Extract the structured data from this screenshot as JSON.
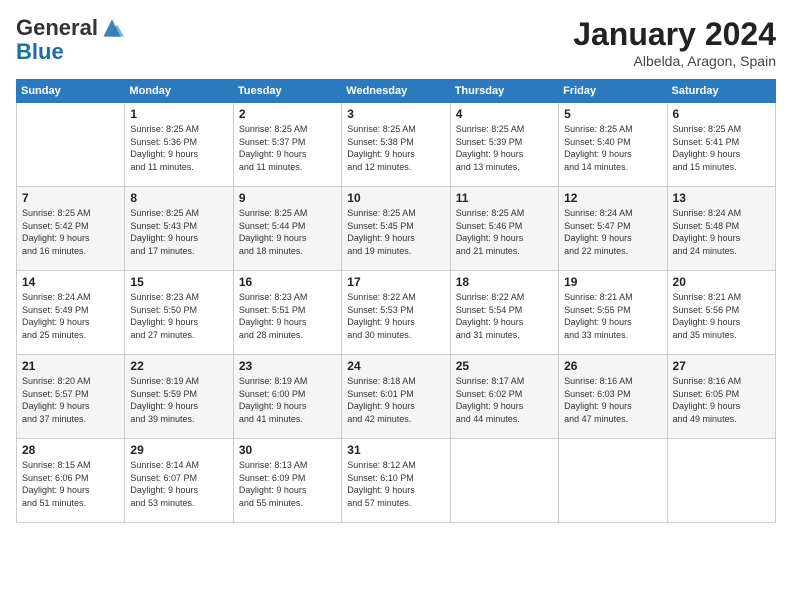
{
  "logo": {
    "general": "General",
    "blue": "Blue"
  },
  "title": "January 2024",
  "subtitle": "Albelda, Aragon, Spain",
  "days_of_week": [
    "Sunday",
    "Monday",
    "Tuesday",
    "Wednesday",
    "Thursday",
    "Friday",
    "Saturday"
  ],
  "weeks": [
    [
      {
        "day": "",
        "info": ""
      },
      {
        "day": "1",
        "info": "Sunrise: 8:25 AM\nSunset: 5:36 PM\nDaylight: 9 hours\nand 11 minutes."
      },
      {
        "day": "2",
        "info": "Sunrise: 8:25 AM\nSunset: 5:37 PM\nDaylight: 9 hours\nand 11 minutes."
      },
      {
        "day": "3",
        "info": "Sunrise: 8:25 AM\nSunset: 5:38 PM\nDaylight: 9 hours\nand 12 minutes."
      },
      {
        "day": "4",
        "info": "Sunrise: 8:25 AM\nSunset: 5:39 PM\nDaylight: 9 hours\nand 13 minutes."
      },
      {
        "day": "5",
        "info": "Sunrise: 8:25 AM\nSunset: 5:40 PM\nDaylight: 9 hours\nand 14 minutes."
      },
      {
        "day": "6",
        "info": "Sunrise: 8:25 AM\nSunset: 5:41 PM\nDaylight: 9 hours\nand 15 minutes."
      }
    ],
    [
      {
        "day": "7",
        "info": "Sunrise: 8:25 AM\nSunset: 5:42 PM\nDaylight: 9 hours\nand 16 minutes."
      },
      {
        "day": "8",
        "info": "Sunrise: 8:25 AM\nSunset: 5:43 PM\nDaylight: 9 hours\nand 17 minutes."
      },
      {
        "day": "9",
        "info": "Sunrise: 8:25 AM\nSunset: 5:44 PM\nDaylight: 9 hours\nand 18 minutes."
      },
      {
        "day": "10",
        "info": "Sunrise: 8:25 AM\nSunset: 5:45 PM\nDaylight: 9 hours\nand 19 minutes."
      },
      {
        "day": "11",
        "info": "Sunrise: 8:25 AM\nSunset: 5:46 PM\nDaylight: 9 hours\nand 21 minutes."
      },
      {
        "day": "12",
        "info": "Sunrise: 8:24 AM\nSunset: 5:47 PM\nDaylight: 9 hours\nand 22 minutes."
      },
      {
        "day": "13",
        "info": "Sunrise: 8:24 AM\nSunset: 5:48 PM\nDaylight: 9 hours\nand 24 minutes."
      }
    ],
    [
      {
        "day": "14",
        "info": "Sunrise: 8:24 AM\nSunset: 5:49 PM\nDaylight: 9 hours\nand 25 minutes."
      },
      {
        "day": "15",
        "info": "Sunrise: 8:23 AM\nSunset: 5:50 PM\nDaylight: 9 hours\nand 27 minutes."
      },
      {
        "day": "16",
        "info": "Sunrise: 8:23 AM\nSunset: 5:51 PM\nDaylight: 9 hours\nand 28 minutes."
      },
      {
        "day": "17",
        "info": "Sunrise: 8:22 AM\nSunset: 5:53 PM\nDaylight: 9 hours\nand 30 minutes."
      },
      {
        "day": "18",
        "info": "Sunrise: 8:22 AM\nSunset: 5:54 PM\nDaylight: 9 hours\nand 31 minutes."
      },
      {
        "day": "19",
        "info": "Sunrise: 8:21 AM\nSunset: 5:55 PM\nDaylight: 9 hours\nand 33 minutes."
      },
      {
        "day": "20",
        "info": "Sunrise: 8:21 AM\nSunset: 5:56 PM\nDaylight: 9 hours\nand 35 minutes."
      }
    ],
    [
      {
        "day": "21",
        "info": "Sunrise: 8:20 AM\nSunset: 5:57 PM\nDaylight: 9 hours\nand 37 minutes."
      },
      {
        "day": "22",
        "info": "Sunrise: 8:19 AM\nSunset: 5:59 PM\nDaylight: 9 hours\nand 39 minutes."
      },
      {
        "day": "23",
        "info": "Sunrise: 8:19 AM\nSunset: 6:00 PM\nDaylight: 9 hours\nand 41 minutes."
      },
      {
        "day": "24",
        "info": "Sunrise: 8:18 AM\nSunset: 6:01 PM\nDaylight: 9 hours\nand 42 minutes."
      },
      {
        "day": "25",
        "info": "Sunrise: 8:17 AM\nSunset: 6:02 PM\nDaylight: 9 hours\nand 44 minutes."
      },
      {
        "day": "26",
        "info": "Sunrise: 8:16 AM\nSunset: 6:03 PM\nDaylight: 9 hours\nand 47 minutes."
      },
      {
        "day": "27",
        "info": "Sunrise: 8:16 AM\nSunset: 6:05 PM\nDaylight: 9 hours\nand 49 minutes."
      }
    ],
    [
      {
        "day": "28",
        "info": "Sunrise: 8:15 AM\nSunset: 6:06 PM\nDaylight: 9 hours\nand 51 minutes."
      },
      {
        "day": "29",
        "info": "Sunrise: 8:14 AM\nSunset: 6:07 PM\nDaylight: 9 hours\nand 53 minutes."
      },
      {
        "day": "30",
        "info": "Sunrise: 8:13 AM\nSunset: 6:09 PM\nDaylight: 9 hours\nand 55 minutes."
      },
      {
        "day": "31",
        "info": "Sunrise: 8:12 AM\nSunset: 6:10 PM\nDaylight: 9 hours\nand 57 minutes."
      },
      {
        "day": "",
        "info": ""
      },
      {
        "day": "",
        "info": ""
      },
      {
        "day": "",
        "info": ""
      }
    ]
  ]
}
